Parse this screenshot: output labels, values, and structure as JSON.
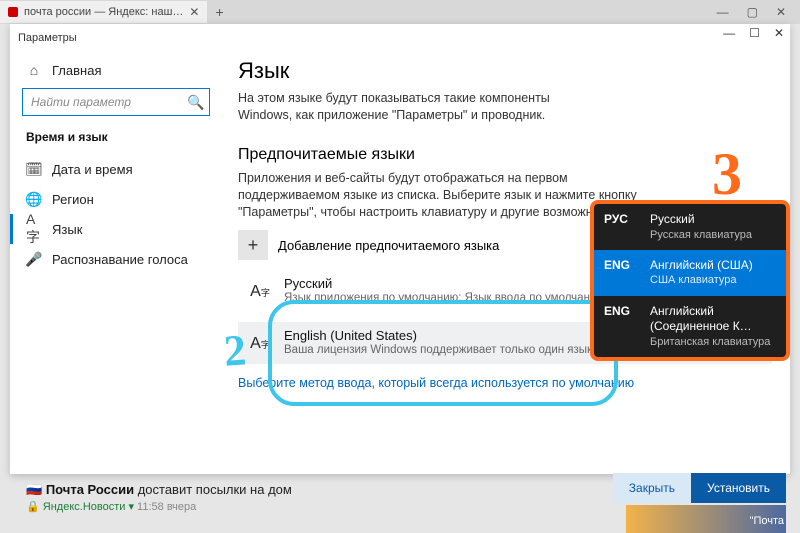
{
  "browser": {
    "tab_title": "почта россии — Яндекс: наш…",
    "minimize": "—",
    "maximize": "▢",
    "close": "✕",
    "new_tab": "+"
  },
  "settings": {
    "window_title": "Параметры",
    "win_minimize": "—",
    "win_maximize": "☐",
    "win_close": "✕",
    "home_label": "Главная",
    "search_placeholder": "Найти параметр",
    "section": "Время и язык",
    "nav": {
      "datetime": "Дата и время",
      "region": "Регион",
      "language": "Язык",
      "speech": "Распознавание голоса"
    }
  },
  "content": {
    "title": "Язык",
    "subtitle": "На этом языке будут показываться такие компоненты Windows, как приложение \"Параметры\" и проводник.",
    "pref_title": "Предпочитаемые языки",
    "pref_desc": "Приложения и веб-сайты будут отображаться на первом поддерживаемом языке из списка. Выберите язык и нажмите кнопку \"Параметры\", чтобы настроить клавиатуру и другие возможности.",
    "add_label": "Добавление предпочитаемого языка",
    "langs": [
      {
        "name": "Русский",
        "sub": "Язык приложения по умолчанию; Язык ввода по умолчанию; Язык интерфейса Windows",
        "indicators": "🖵 ⌨"
      },
      {
        "name": "English (United States)",
        "sub": "Ваша лицензия Windows поддерживает только один язык интерфейса",
        "indicators": "🖵 🎤 📅 ⌨"
      }
    ],
    "link": "Выберите метод ввода, который всегда используется по умолчанию"
  },
  "flyout": {
    "items": [
      {
        "code": "РУС",
        "name": "Русский",
        "sub": "Русская клавиатура",
        "sel": false
      },
      {
        "code": "ENG",
        "name": "Английский (США)",
        "sub": "США клавиатура",
        "sel": true
      },
      {
        "code": "ENG",
        "name": "Английский (Соединенное К…",
        "sub": "Британская клавиатура",
        "sel": false
      }
    ]
  },
  "annotations": {
    "two": "2",
    "three": "3"
  },
  "snack": {
    "close": "Закрыть",
    "install": "Установить"
  },
  "news": {
    "title_bold": "Почта России",
    "title_rest": " доставит посылки на дом",
    "source": "Яндекс.Новости",
    "time": "11:58 вчера"
  },
  "peek": "\"Почта"
}
